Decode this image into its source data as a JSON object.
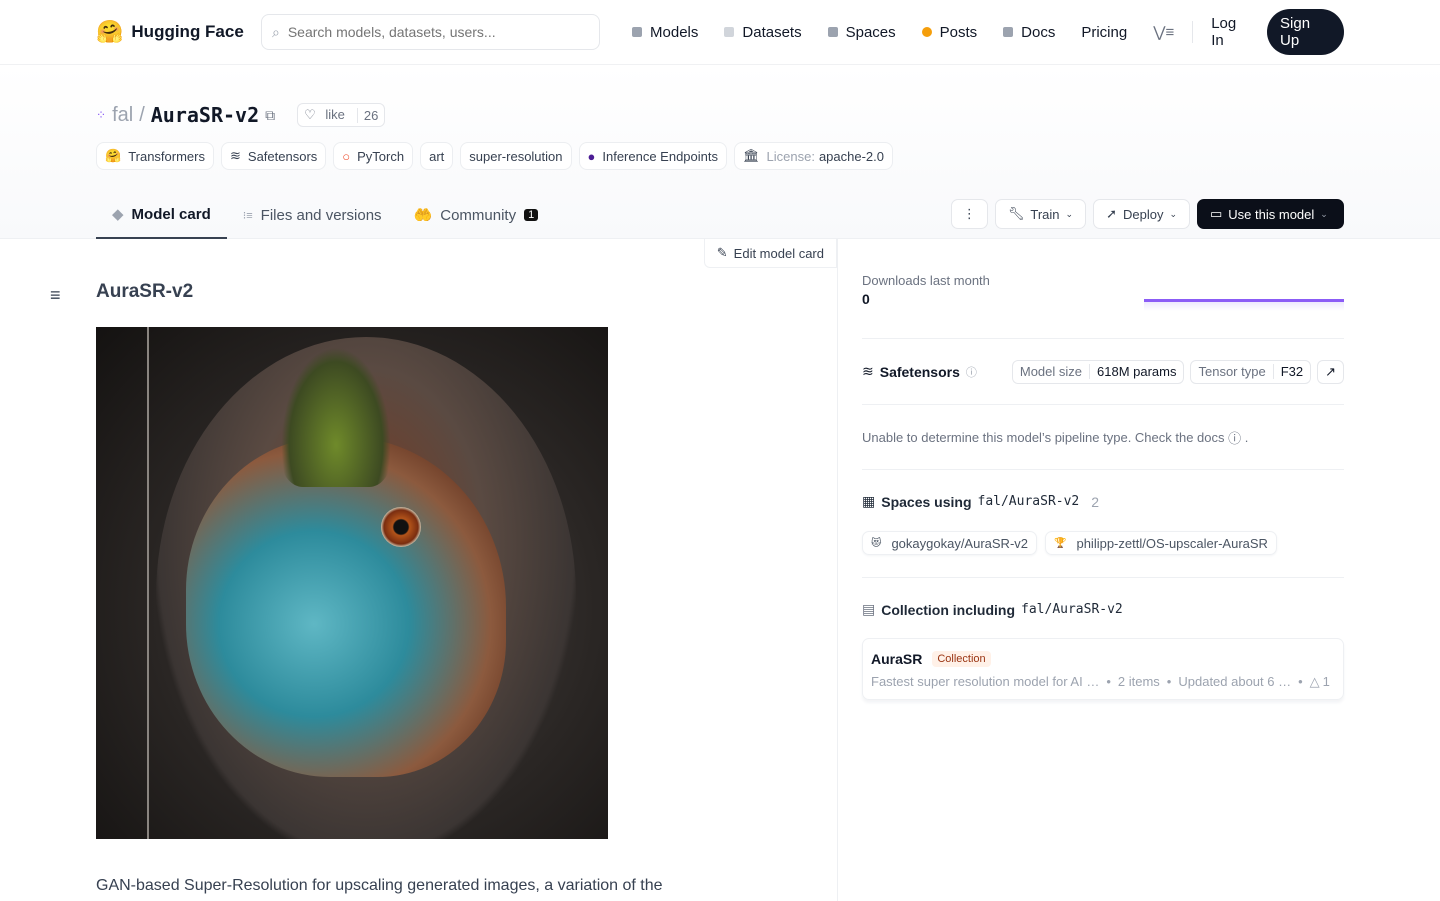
{
  "nav": {
    "brand": "Hugging Face",
    "search_placeholder": "Search models, datasets, users...",
    "links": [
      {
        "label": "Models",
        "color": "#9ca3af"
      },
      {
        "label": "Datasets",
        "color": "#d1d5db"
      },
      {
        "label": "Spaces",
        "color": "#9ca3af"
      },
      {
        "label": "Posts",
        "color": "#f59e0b"
      },
      {
        "label": "Docs",
        "color": "#9ca3af"
      },
      {
        "label": "Pricing"
      }
    ],
    "login": "Log In",
    "signup": "Sign Up"
  },
  "repo": {
    "org": "fal",
    "name": "AuraSR-v2",
    "like": "like",
    "likes": "26",
    "tags": [
      "Transformers",
      "Safetensors",
      "PyTorch",
      "art",
      "super-resolution",
      "Inference Endpoints"
    ],
    "license_label": "License:",
    "license": "apache-2.0"
  },
  "tabs": [
    {
      "label": "Model card"
    },
    {
      "label": "Files and versions"
    },
    {
      "label": "Community",
      "badge": "1"
    }
  ],
  "actions": {
    "train": "Train",
    "deploy": "Deploy",
    "use": "Use this model"
  },
  "card": {
    "edit": "Edit model card",
    "title": "AuraSR-v2",
    "description": "GAN-based Super-Resolution for upscaling generated images, a variation of the"
  },
  "side": {
    "downloads_label": "Downloads last month",
    "downloads": "0",
    "safetensors": "Safetensors",
    "model_size_label": "Model size",
    "model_size": "618M params",
    "tensor_type_label": "Tensor type",
    "tensor_type": "F32",
    "pipeline_msg": "Unable to determine this model’s pipeline type. Check the docs",
    "spaces_title": "Spaces using",
    "repo_id": "fal/AuraSR-v2",
    "spaces_count": "2",
    "spaces": [
      "gokaygokay/AuraSR-v2",
      "philipp-zettl/OS-upscaler-AuraSR"
    ],
    "collection_title": "Collection including",
    "collection": {
      "name": "AuraSR",
      "badge": "Collection",
      "desc": "Fastest super resolution model for AI …",
      "items": "2 items",
      "updated": "Updated about 6 …",
      "upvotes": "1"
    }
  },
  "accent": "#8b5cf6"
}
